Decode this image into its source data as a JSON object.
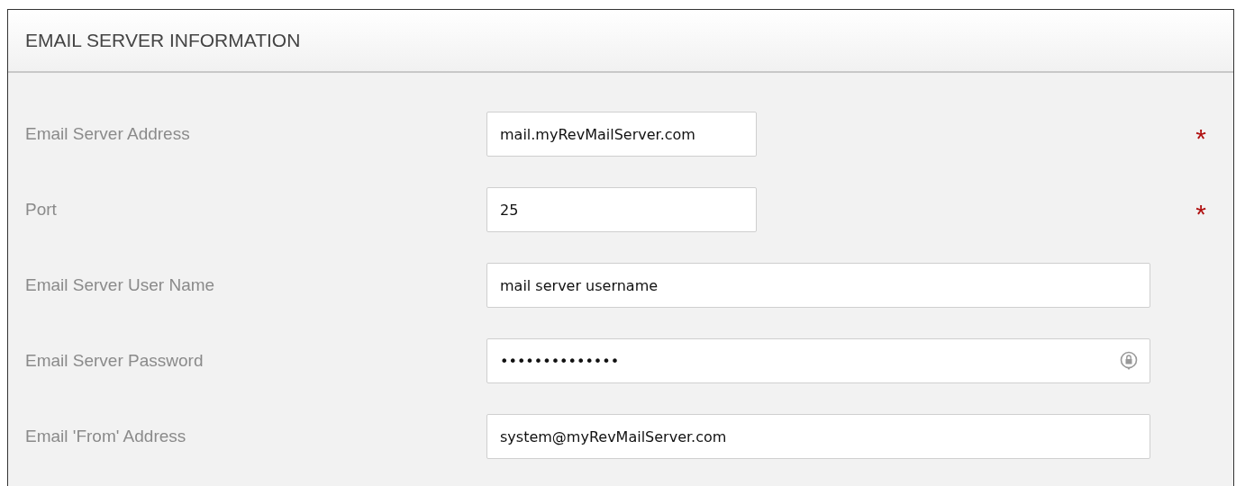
{
  "panel": {
    "title": "EMAIL SERVER INFORMATION"
  },
  "required_marker": "*",
  "fields": [
    {
      "label": "Email Server Address",
      "value": "mail.myRevMailServer.com",
      "kind": "short",
      "required": true
    },
    {
      "label": "Port",
      "value": "25",
      "kind": "short",
      "required": true
    },
    {
      "label": "Email Server User Name",
      "value": "mail server username",
      "kind": "long",
      "required": false
    },
    {
      "label": "Email Server Password",
      "value": "••••••••••••••",
      "kind": "password",
      "required": false
    },
    {
      "label": "Email 'From' Address",
      "value": "system@myRevMailServer.com",
      "kind": "long",
      "required": false
    }
  ]
}
